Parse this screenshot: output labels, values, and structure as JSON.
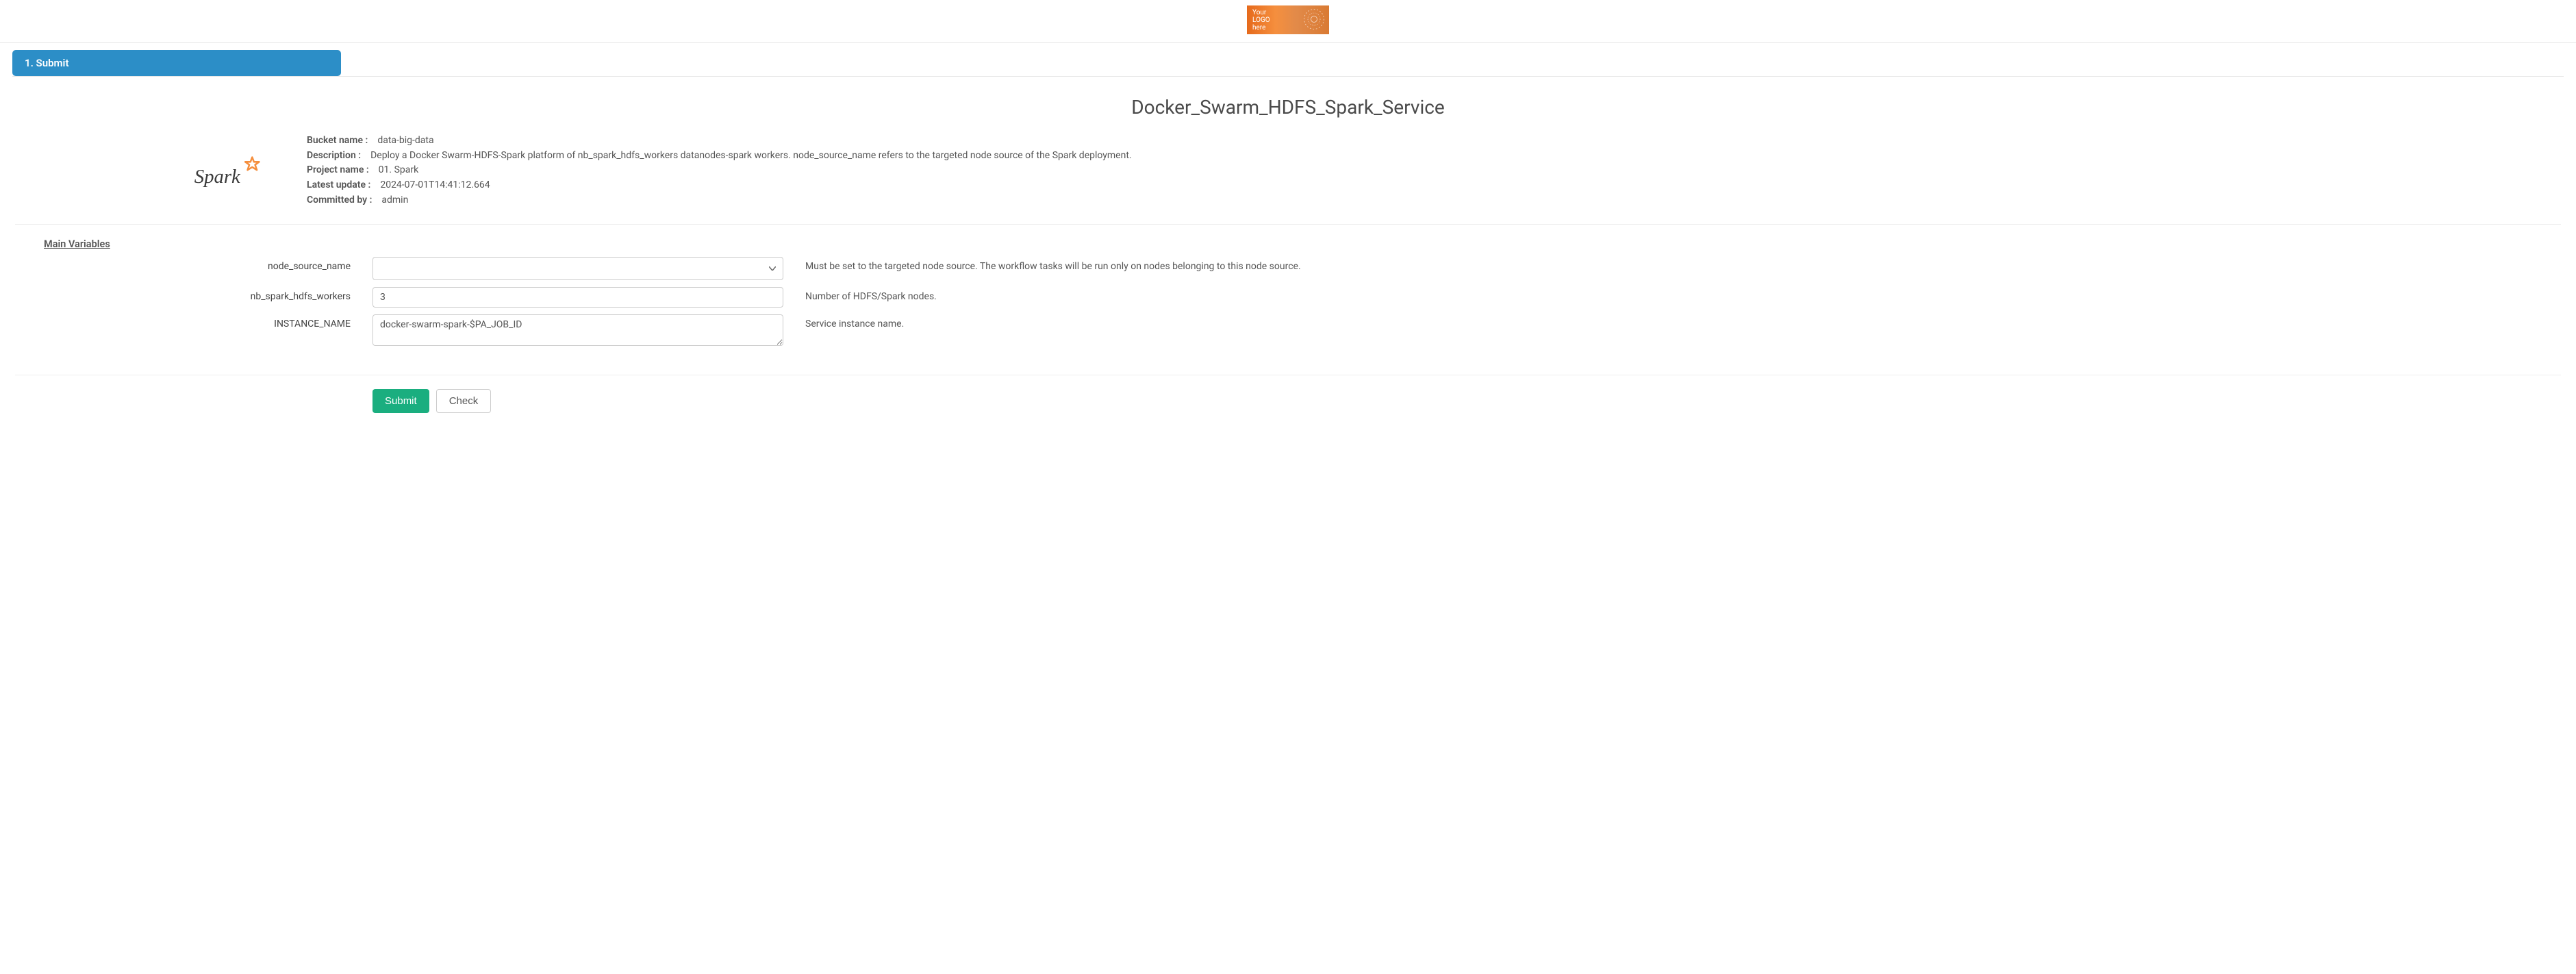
{
  "logo": {
    "line1": "Your",
    "line2": "LOGO",
    "line3": "here"
  },
  "tabs": {
    "active": "1. Submit"
  },
  "title": "Docker_Swarm_HDFS_Spark_Service",
  "meta": {
    "bucket_label": "Bucket name :",
    "bucket_value": "data-big-data",
    "description_label": "Description :",
    "description_value": "Deploy a Docker Swarm-HDFS-Spark platform of nb_spark_hdfs_workers datanodes-spark workers. node_source_name refers to the targeted node source of the Spark deployment.",
    "project_label": "Project name :",
    "project_value": "01. Spark",
    "updated_label": "Latest update :",
    "updated_value": "2024-07-01T14:41:12.664",
    "committed_label": "Committed by :",
    "committed_value": "admin"
  },
  "section_title": "Main Variables",
  "fields": {
    "node_source_name": {
      "label": "node_source_name",
      "value": "",
      "help": "Must be set to the targeted node source. The workflow tasks will be run only on nodes belonging to this node source."
    },
    "nb_spark_hdfs_workers": {
      "label": "nb_spark_hdfs_workers",
      "value": "3",
      "help": "Number of HDFS/Spark nodes."
    },
    "instance_name": {
      "label": "INSTANCE_NAME",
      "value": "docker-swarm-spark-$PA_JOB_ID",
      "help": "Service instance name."
    }
  },
  "buttons": {
    "submit": "Submit",
    "check": "Check"
  }
}
